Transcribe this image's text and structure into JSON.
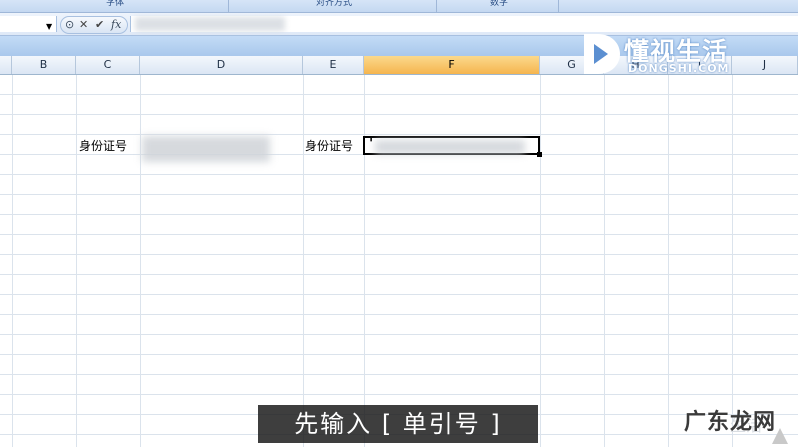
{
  "ribbon": {
    "groups": [
      {
        "label": "字体"
      },
      {
        "label": "对齐方式"
      },
      {
        "label": "数字"
      }
    ]
  },
  "formula_bar": {
    "fx_label": "fx"
  },
  "columns": [
    "B",
    "C",
    "D",
    "E",
    "F",
    "G",
    "H",
    "I",
    "J"
  ],
  "active_column": "F",
  "cells": {
    "c_label": "身份证号",
    "e_label": "身份证号",
    "f_value": "'"
  },
  "logo": {
    "title": "懂视生活",
    "subtitle": "DONGSHI.COM"
  },
  "subtitle": "先输入 [ 单引号 ]",
  "watermark": {
    "text": "广东龙网",
    "faint": "生活"
  },
  "colors": {
    "accent_orange": "#f5b54f",
    "ribbon_blue": "#c4d8f1",
    "subtitle_bg": "#1e1e1e"
  }
}
